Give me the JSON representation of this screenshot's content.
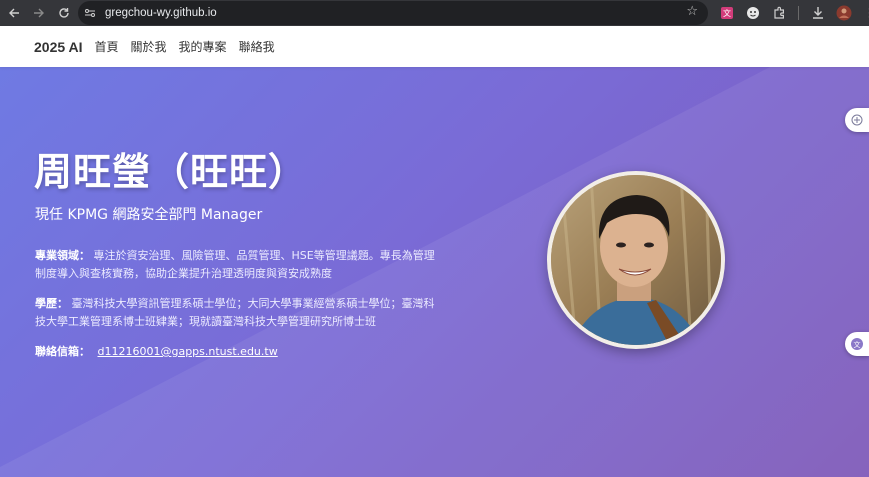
{
  "browser": {
    "url": "gregchou-wy.github.io"
  },
  "nav": {
    "brand": "2025 AI",
    "links": [
      "首頁",
      "關於我",
      "我的專案",
      "聯絡我"
    ]
  },
  "hero": {
    "title": "周旺瑩（旺旺）",
    "subtitle": "現任 KPMG 網路安全部門 Manager",
    "expertise_label": "專業領域：",
    "expertise_text": "專注於資安治理、風險管理、品質管理、HSE等管理議題。專長為管理制度導入與查核實務，協助企業提升治理透明度與資安成熟度",
    "education_label": "學歷：",
    "education_text": "臺灣科技大學資訊管理系碩士學位；大同大學事業經營系碩士學位；臺灣科技大學工業管理系博士班肄業；現就讀臺灣科技大學管理研究所博士班",
    "email_label": "聯絡信箱：",
    "email": "d11216001@gapps.ntust.edu.tw"
  },
  "colors": {
    "hero_start": "#6f7ae3",
    "hero_end": "#7d58b8",
    "browser_bar": "#35363a"
  },
  "icons": [
    "back-icon",
    "forward-icon",
    "reload-icon",
    "site-info-icon",
    "star-icon",
    "extension-icon",
    "download-icon",
    "profile-icon",
    "menu-icon"
  ]
}
